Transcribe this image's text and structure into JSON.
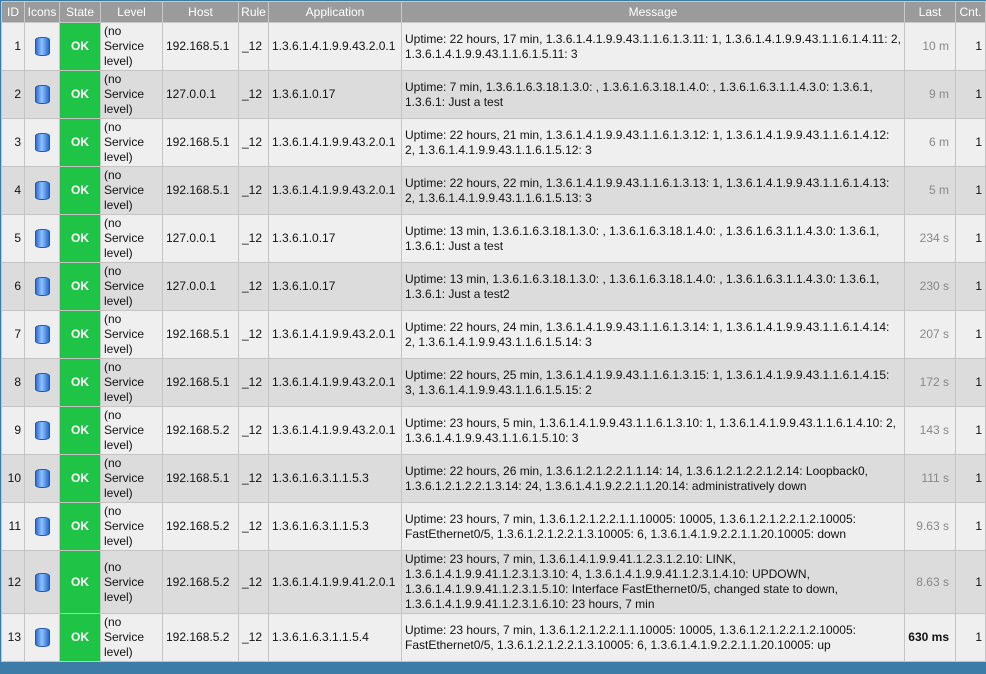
{
  "columns": [
    "ID",
    "Icons",
    "State",
    "Level",
    "Host",
    "Rule",
    "Application",
    "Message",
    "Last",
    "Cnt."
  ],
  "rows": [
    {
      "id": "1",
      "state": "OK",
      "level": "(no Service level)",
      "host": "192.168.5.1",
      "rule": "_12",
      "app": "1.3.6.1.4.1.9.9.43.2.0.1",
      "msg": "Uptime: 22 hours, 17 min, 1.3.6.1.4.1.9.9.43.1.1.6.1.3.11: 1, 1.3.6.1.4.1.9.9.43.1.1.6.1.4.11: 2, 1.3.6.1.4.1.9.9.43.1.1.6.1.5.11: 3",
      "last": "10 m",
      "cnt": "1",
      "icon": "database-icon"
    },
    {
      "id": "2",
      "state": "OK",
      "level": "(no Service level)",
      "host": "127.0.0.1",
      "rule": "_12",
      "app": "1.3.6.1.0.17",
      "msg": "Uptime: 7 min, 1.3.6.1.6.3.18.1.3.0: , 1.3.6.1.6.3.18.1.4.0: , 1.3.6.1.6.3.1.1.4.3.0: 1.3.6.1, 1.3.6.1: Just a test",
      "last": "9 m",
      "cnt": "1",
      "icon": "database-icon"
    },
    {
      "id": "3",
      "state": "OK",
      "level": "(no Service level)",
      "host": "192.168.5.1",
      "rule": "_12",
      "app": "1.3.6.1.4.1.9.9.43.2.0.1",
      "msg": "Uptime: 22 hours, 21 min, 1.3.6.1.4.1.9.9.43.1.1.6.1.3.12: 1, 1.3.6.1.4.1.9.9.43.1.1.6.1.4.12: 2, 1.3.6.1.4.1.9.9.43.1.1.6.1.5.12: 3",
      "last": "6 m",
      "cnt": "1",
      "icon": "database-icon"
    },
    {
      "id": "4",
      "state": "OK",
      "level": "(no Service level)",
      "host": "192.168.5.1",
      "rule": "_12",
      "app": "1.3.6.1.4.1.9.9.43.2.0.1",
      "msg": "Uptime: 22 hours, 22 min, 1.3.6.1.4.1.9.9.43.1.1.6.1.3.13: 1, 1.3.6.1.4.1.9.9.43.1.1.6.1.4.13: 2, 1.3.6.1.4.1.9.9.43.1.1.6.1.5.13: 3",
      "last": "5 m",
      "cnt": "1",
      "icon": "database-icon"
    },
    {
      "id": "5",
      "state": "OK",
      "level": "(no Service level)",
      "host": "127.0.0.1",
      "rule": "_12",
      "app": "1.3.6.1.0.17",
      "msg": "Uptime: 13 min, 1.3.6.1.6.3.18.1.3.0: , 1.3.6.1.6.3.18.1.4.0: , 1.3.6.1.6.3.1.1.4.3.0: 1.3.6.1, 1.3.6.1: Just a test",
      "last": "234 s",
      "cnt": "1",
      "icon": "database-icon"
    },
    {
      "id": "6",
      "state": "OK",
      "level": "(no Service level)",
      "host": "127.0.0.1",
      "rule": "_12",
      "app": "1.3.6.1.0.17",
      "msg": "Uptime: 13 min, 1.3.6.1.6.3.18.1.3.0: , 1.3.6.1.6.3.18.1.4.0: , 1.3.6.1.6.3.1.1.4.3.0: 1.3.6.1, 1.3.6.1: Just a test2",
      "last": "230 s",
      "cnt": "1",
      "icon": "database-icon"
    },
    {
      "id": "7",
      "state": "OK",
      "level": "(no Service level)",
      "host": "192.168.5.1",
      "rule": "_12",
      "app": "1.3.6.1.4.1.9.9.43.2.0.1",
      "msg": "Uptime: 22 hours, 24 min, 1.3.6.1.4.1.9.9.43.1.1.6.1.3.14: 1, 1.3.6.1.4.1.9.9.43.1.1.6.1.4.14: 2, 1.3.6.1.4.1.9.9.43.1.1.6.1.5.14: 3",
      "last": "207 s",
      "cnt": "1",
      "icon": "database-icon"
    },
    {
      "id": "8",
      "state": "OK",
      "level": "(no Service level)",
      "host": "192.168.5.1",
      "rule": "_12",
      "app": "1.3.6.1.4.1.9.9.43.2.0.1",
      "msg": "Uptime: 22 hours, 25 min, 1.3.6.1.4.1.9.9.43.1.1.6.1.3.15: 1, 1.3.6.1.4.1.9.9.43.1.1.6.1.4.15: 3, 1.3.6.1.4.1.9.9.43.1.1.6.1.5.15: 2",
      "last": "172 s",
      "cnt": "1",
      "icon": "database-icon"
    },
    {
      "id": "9",
      "state": "OK",
      "level": "(no Service level)",
      "host": "192.168.5.2",
      "rule": "_12",
      "app": "1.3.6.1.4.1.9.9.43.2.0.1",
      "msg": "Uptime: 23 hours, 5 min, 1.3.6.1.4.1.9.9.43.1.1.6.1.3.10: 1, 1.3.6.1.4.1.9.9.43.1.1.6.1.4.10: 2, 1.3.6.1.4.1.9.9.43.1.1.6.1.5.10: 3",
      "last": "143 s",
      "cnt": "1",
      "icon": "database-icon"
    },
    {
      "id": "10",
      "state": "OK",
      "level": "(no Service level)",
      "host": "192.168.5.1",
      "rule": "_12",
      "app": "1.3.6.1.6.3.1.1.5.3",
      "msg": "Uptime: 22 hours, 26 min, 1.3.6.1.2.1.2.2.1.1.14: 14, 1.3.6.1.2.1.2.2.1.2.14: Loopback0, 1.3.6.1.2.1.2.2.1.3.14: 24, 1.3.6.1.4.1.9.2.2.1.1.20.14: administratively down",
      "last": "111 s",
      "cnt": "1",
      "icon": "database-icon"
    },
    {
      "id": "11",
      "state": "OK",
      "level": "(no Service level)",
      "host": "192.168.5.2",
      "rule": "_12",
      "app": "1.3.6.1.6.3.1.1.5.3",
      "msg": "Uptime: 23 hours, 7 min, 1.3.6.1.2.1.2.2.1.1.10005: 10005, 1.3.6.1.2.1.2.2.1.2.10005: FastEthernet0/5, 1.3.6.1.2.1.2.2.1.3.10005: 6, 1.3.6.1.4.1.9.2.2.1.1.20.10005: down",
      "last": "9.63 s",
      "cnt": "1",
      "icon": "database-icon"
    },
    {
      "id": "12",
      "state": "OK",
      "level": "(no Service level)",
      "host": "192.168.5.2",
      "rule": "_12",
      "app": "1.3.6.1.4.1.9.9.41.2.0.1",
      "msg": "Uptime: 23 hours, 7 min, 1.3.6.1.4.1.9.9.41.1.2.3.1.2.10: LINK, 1.3.6.1.4.1.9.9.41.1.2.3.1.3.10: 4, 1.3.6.1.4.1.9.9.41.1.2.3.1.4.10: UPDOWN, 1.3.6.1.4.1.9.9.41.1.2.3.1.5.10: Interface FastEthernet0/5, changed state to down, 1.3.6.1.4.1.9.9.41.1.2.3.1.6.10: 23 hours, 7 min",
      "last": "8.63 s",
      "cnt": "1",
      "icon": "database-icon"
    },
    {
      "id": "13",
      "state": "OK",
      "level": "(no Service level)",
      "host": "192.168.5.2",
      "rule": "_12",
      "app": "1.3.6.1.6.3.1.1.5.4",
      "msg": "Uptime: 23 hours, 7 min, 1.3.6.1.2.1.2.2.1.1.10005: 10005, 1.3.6.1.2.1.2.2.1.2.10005: FastEthernet0/5, 1.3.6.1.2.1.2.2.1.3.10005: 6, 1.3.6.1.4.1.9.2.2.1.1.20.10005: up",
      "last": "630 ms",
      "cnt": "1",
      "icon": "database-icon"
    }
  ],
  "colors": {
    "header": "#9b9b9b",
    "ok": "#1fc446",
    "row_light": "#efefef",
    "row_dark": "#dcdcdc",
    "frame": "#3d7ca6"
  }
}
